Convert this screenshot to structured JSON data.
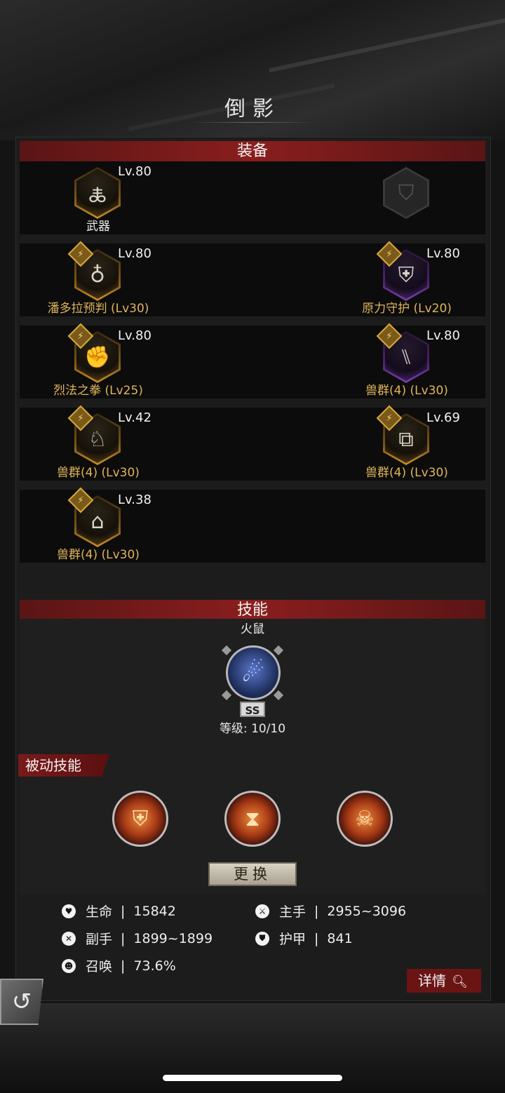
{
  "page": {
    "title": "倒影"
  },
  "equipment": {
    "header": "装备",
    "rows": [
      [
        {
          "level": "Lv.80",
          "name": "武器",
          "rarity": "gold",
          "badge": false,
          "icon": "dragon-wing-icon"
        },
        {
          "level": "",
          "name": "",
          "rarity": "empty",
          "badge": false,
          "icon": "shield-icon"
        }
      ],
      [
        {
          "level": "Lv.80",
          "name": "潘多拉预判 (Lv30)",
          "rarity": "gold",
          "badge": true,
          "icon": "amulet-icon"
        },
        {
          "level": "Lv.80",
          "name": "原力守护 (Lv20)",
          "rarity": "purple",
          "badge": true,
          "icon": "chest-armor-icon"
        }
      ],
      [
        {
          "level": "Lv.80",
          "name": "烈法之拳 (Lv25)",
          "rarity": "gold",
          "badge": true,
          "icon": "gauntlet-icon"
        },
        {
          "level": "Lv.80",
          "name": "兽群(4) (Lv30)",
          "rarity": "purple",
          "badge": true,
          "icon": "boots-icon"
        }
      ],
      [
        {
          "level": "Lv.42",
          "name": "兽群(4) (Lv30)",
          "rarity": "gold",
          "badge": true,
          "icon": "pouch-icon"
        },
        {
          "level": "Lv.69",
          "name": "兽群(4) (Lv30)",
          "rarity": "gold",
          "badge": true,
          "icon": "belt-icon"
        }
      ],
      [
        {
          "level": "Lv.38",
          "name": "兽群(4) (Lv30)",
          "rarity": "gold",
          "badge": true,
          "icon": "robe-icon"
        }
      ]
    ]
  },
  "skills": {
    "header": "技能",
    "active_name": "火鼠",
    "grade": "SS",
    "level_text": "等级: 10/10",
    "passive_label": "被动技能",
    "passives": [
      {
        "icon": "shield-fist-icon",
        "glyph": "⛨"
      },
      {
        "icon": "hourglass-icon",
        "glyph": "⧗"
      },
      {
        "icon": "skull-claw-icon",
        "glyph": "☠"
      }
    ],
    "swap_label": "更换"
  },
  "stats": {
    "hp_label": "生命",
    "hp_value": "15842",
    "main_hand_label": "主手",
    "main_hand_value": "2955~3096",
    "off_hand_label": "副手",
    "off_hand_value": "1899~1899",
    "armor_label": "护甲",
    "armor_value": "841",
    "summon_label": "召唤",
    "summon_value": "73.6%",
    "separator": "|"
  },
  "buttons": {
    "detail_label": "详情"
  }
}
